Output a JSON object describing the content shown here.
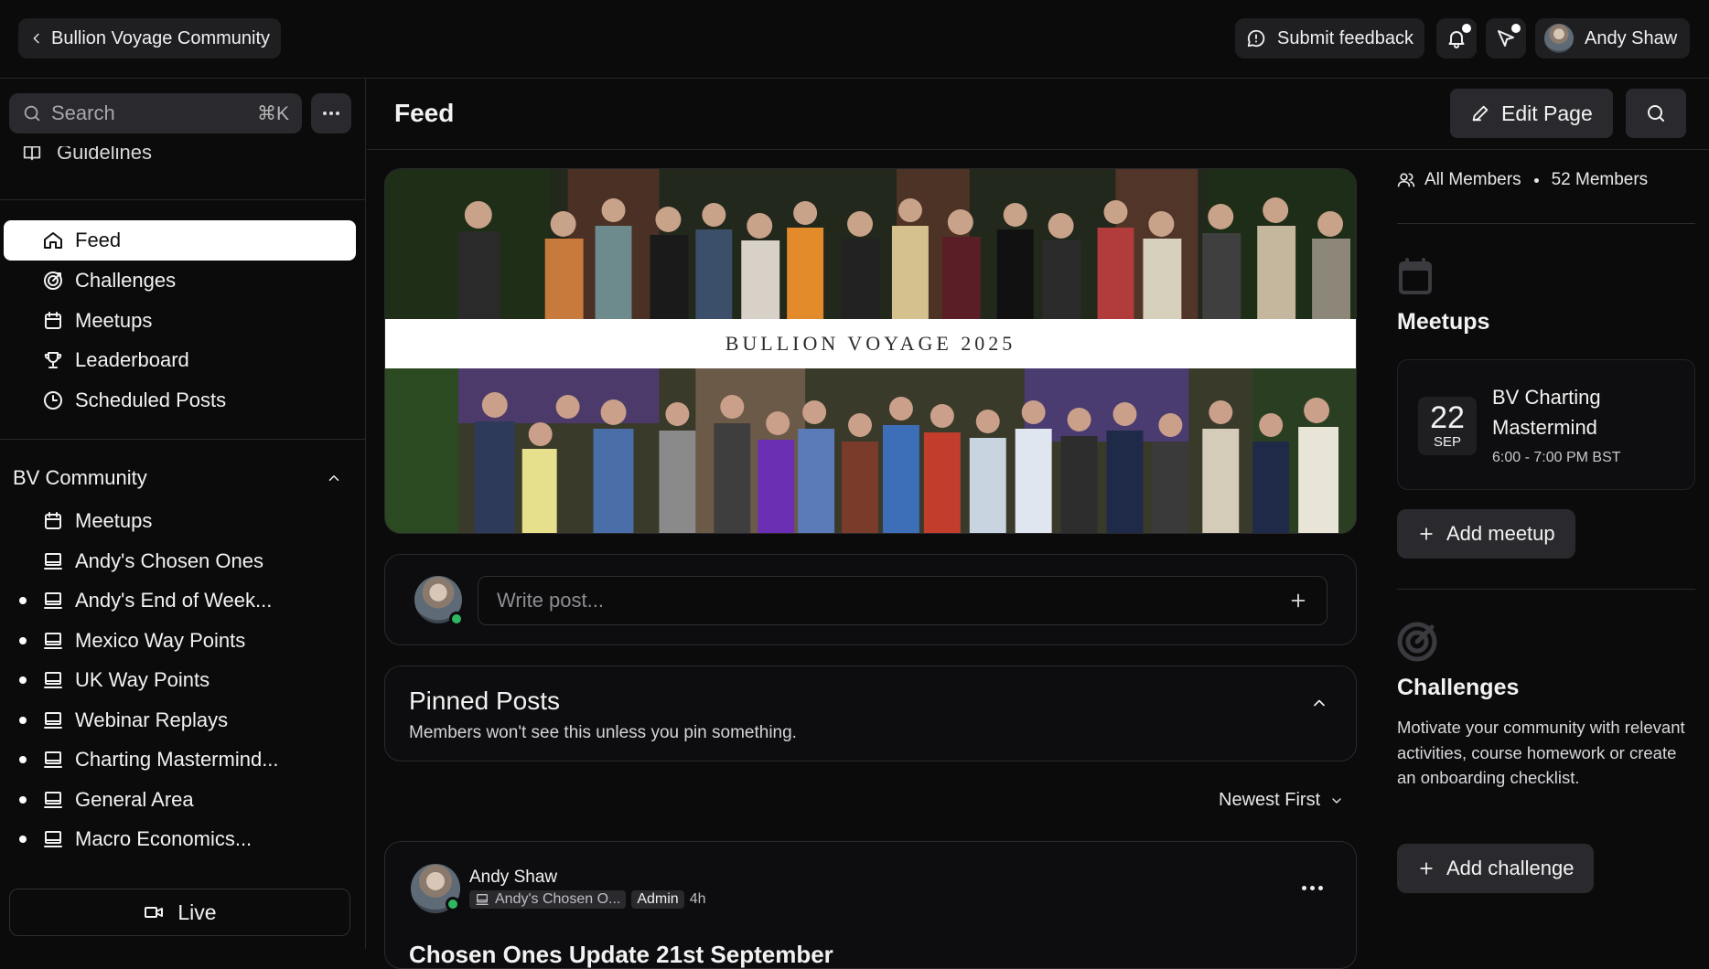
{
  "topbar": {
    "community_name": "Bullion Voyage Community",
    "feedback_label": "Submit feedback",
    "user_name": "Andy Shaw"
  },
  "sidebar": {
    "search_placeholder": "Search",
    "search_shortcut": "⌘K",
    "guidelines_label": "Guidelines",
    "nav": [
      {
        "label": "Feed",
        "icon": "home-icon",
        "active": true
      },
      {
        "label": "Challenges",
        "icon": "target-icon"
      },
      {
        "label": "Meetups",
        "icon": "calendar-icon"
      },
      {
        "label": "Leaderboard",
        "icon": "trophy-icon"
      },
      {
        "label": "Scheduled Posts",
        "icon": "clock-icon"
      }
    ],
    "group_title": "BV Community",
    "group_items": [
      {
        "label": "Meetups",
        "icon": "calendar-icon",
        "unread": false
      },
      {
        "label": "Andy's Chosen Ones",
        "icon": "monitor-icon",
        "unread": false
      },
      {
        "label": "Andy's End of Week...",
        "icon": "monitor-icon",
        "unread": true
      },
      {
        "label": "Mexico Way Points",
        "icon": "monitor-icon",
        "unread": true
      },
      {
        "label": "UK Way Points",
        "icon": "monitor-icon",
        "unread": true
      },
      {
        "label": "Webinar Replays",
        "icon": "monitor-icon",
        "unread": true
      },
      {
        "label": "Charting Mastermind...",
        "icon": "monitor-icon",
        "unread": true
      },
      {
        "label": "General Area",
        "icon": "monitor-icon",
        "unread": true
      },
      {
        "label": "Macro Economics...",
        "icon": "monitor-icon",
        "unread": true
      }
    ],
    "live_label": "Live"
  },
  "main": {
    "title": "Feed",
    "edit_label": "Edit Page",
    "banner_caption": "BULLION VOYAGE 2025",
    "composer_placeholder": "Write post...",
    "pinned_title": "Pinned Posts",
    "pinned_subtitle": "Members won't see this unless you pin something.",
    "sort_label": "Newest First",
    "post": {
      "author": "Andy Shaw",
      "space": "Andy's Chosen O...",
      "role": "Admin",
      "time": "4h",
      "title": "Chosen Ones Update 21st September"
    }
  },
  "right_panel": {
    "members_label": "All Members",
    "members_count": "52 Members",
    "meetups_title": "Meetups",
    "meetup": {
      "day": "22",
      "month": "SEP",
      "name": "BV Charting Mastermind",
      "time": "6:00 - 7:00 PM BST"
    },
    "add_meetup_label": "Add meetup",
    "challenges_title": "Challenges",
    "challenges_desc": "Motivate your community with relevant activities, course homework or create an onboarding checklist.",
    "add_challenge_label": "Add challenge"
  },
  "colors": {
    "background": "#0b0b0c",
    "surface": "#2a2a2e",
    "online": "#2fb863",
    "active_nav": "#ffffff"
  }
}
